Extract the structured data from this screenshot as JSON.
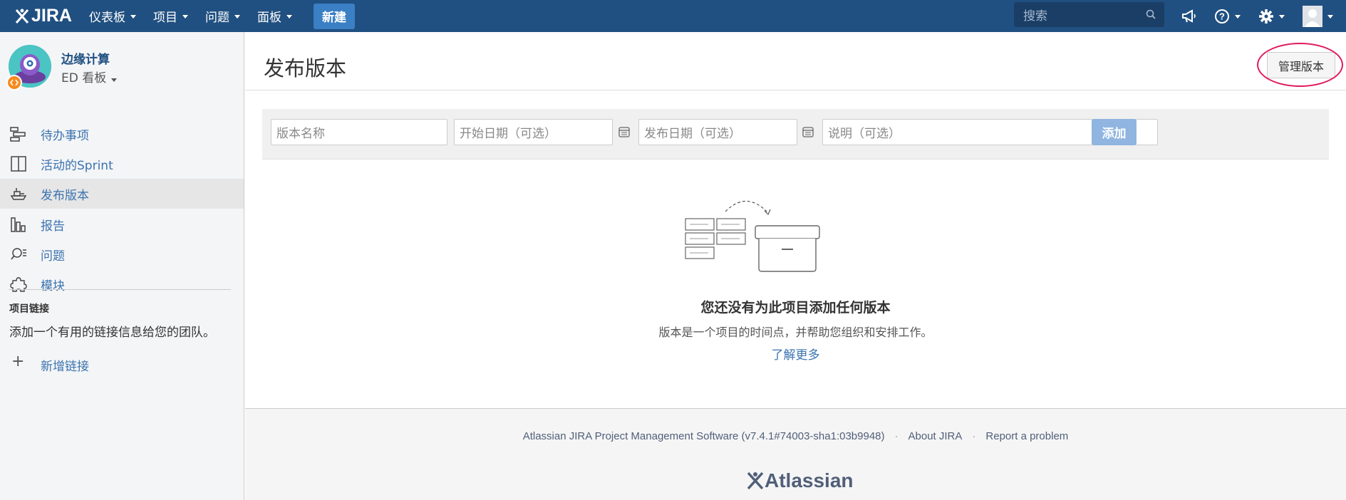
{
  "app": {
    "logo_text": "JIRA"
  },
  "nav": {
    "items": [
      {
        "label": "仪表板"
      },
      {
        "label": "项目"
      },
      {
        "label": "问题"
      },
      {
        "label": "面板"
      }
    ],
    "create_label": "新建",
    "search_placeholder": "搜索"
  },
  "sidebar": {
    "project_name": "边缘计算",
    "board_name": "ED 看板",
    "items": [
      {
        "label": "待办事项",
        "icon": "backlog-icon"
      },
      {
        "label": "活动的Sprint",
        "icon": "sprint-board-icon"
      },
      {
        "label": "发布版本",
        "icon": "ship-icon",
        "active": true
      },
      {
        "label": "报告",
        "icon": "reports-icon"
      },
      {
        "label": "问题",
        "icon": "issues-search-icon"
      },
      {
        "label": "模块",
        "icon": "puzzle-icon"
      }
    ],
    "links_heading": "项目链接",
    "links_text": "添加一个有用的链接信息给您的团队。",
    "add_link_label": "新增链接"
  },
  "main": {
    "title": "发布版本",
    "manage_button": "管理版本",
    "form": {
      "name_placeholder": "版本名称",
      "start_placeholder": "开始日期（可选）",
      "release_placeholder": "发布日期（可选）",
      "desc_placeholder": "说明（可选）",
      "add_label": "添加"
    },
    "empty": {
      "title": "您还没有为此项目添加任何版本",
      "description": "版本是一个项目的时间点，并帮助您组织和安排工作。",
      "link": "了解更多"
    }
  },
  "footer": {
    "software": "Atlassian JIRA Project Management Software (v7.4.1#74003-sha1:03b9948)",
    "about": "About JIRA",
    "report": "Report a problem",
    "brand": "Atlassian"
  },
  "colors": {
    "header": "#205081",
    "link": "#3b73af",
    "create_button": "#3b7fc4",
    "annotation_circle": "#e0195a"
  }
}
